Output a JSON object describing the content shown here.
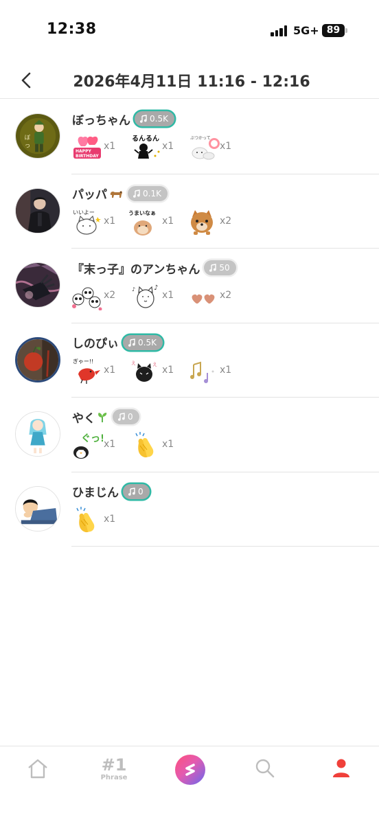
{
  "status_bar": {
    "time": "12:38",
    "network": "5G+",
    "battery": "89"
  },
  "header": {
    "title": "2026年4月11日 11:16 - 12:16"
  },
  "listeners": [
    {
      "name": "ぼっちゃん",
      "badge": "0.5K",
      "badge_style": "teal",
      "stickers": [
        {
          "icon": "happy-birthday-balloon-sticker",
          "count": "x1"
        },
        {
          "icon": "running-silhouette-sticker",
          "count": "x1"
        },
        {
          "icon": "cat-music-sticker",
          "count": "x1"
        }
      ]
    },
    {
      "name": "パッパ",
      "badge": "0.1K",
      "badge_style": "gray",
      "stickers": [
        {
          "icon": "white-cat-iiyo-sticker",
          "count": "x1"
        },
        {
          "icon": "hamster-umainaa-sticker",
          "count": "x1"
        },
        {
          "icon": "shiba-dog-sticker",
          "count": "x2"
        }
      ]
    },
    {
      "name": "『末っ子』のアンちゃん",
      "badge": "50",
      "badge_style": "gray",
      "stickers": [
        {
          "icon": "panda-trio-sticker",
          "count": "x2"
        },
        {
          "icon": "singing-cat-sticker",
          "count": "x1"
        },
        {
          "icon": "hearts-sticker",
          "count": "x2"
        }
      ]
    },
    {
      "name": "しのぴぃ",
      "badge": "0.5K",
      "badge_style": "teal",
      "stickers": [
        {
          "icon": "red-bird-sticker",
          "count": "x1"
        },
        {
          "icon": "black-cat-sticker",
          "count": "x1"
        },
        {
          "icon": "music-notes-sticker",
          "count": "x1"
        }
      ]
    },
    {
      "name": "やく",
      "badge": "0",
      "badge_style": "gray",
      "stickers": [
        {
          "icon": "penguin-thumbs-up-sticker",
          "count": "x1"
        },
        {
          "icon": "clapping-hands-sticker",
          "count": "x1"
        }
      ]
    },
    {
      "name": "ひまじん",
      "badge": "0",
      "badge_style": "teal",
      "stickers": [
        {
          "icon": "clapping-hands-sticker",
          "count": "x1"
        }
      ]
    }
  ],
  "tab_bar": {
    "items": [
      {
        "icon": "home-icon"
      },
      {
        "icon": "phrase-icon",
        "number": "#1",
        "label": "Phrase"
      },
      {
        "icon": "create-icon"
      },
      {
        "icon": "search-icon"
      },
      {
        "icon": "profile-icon",
        "active": true
      }
    ],
    "active_color": "#f0403a",
    "inactive_color": "#bdbdbd"
  },
  "colors": {
    "badge_ring_teal": "#2fb9a5",
    "badge_fill": "#a9a9a9"
  }
}
